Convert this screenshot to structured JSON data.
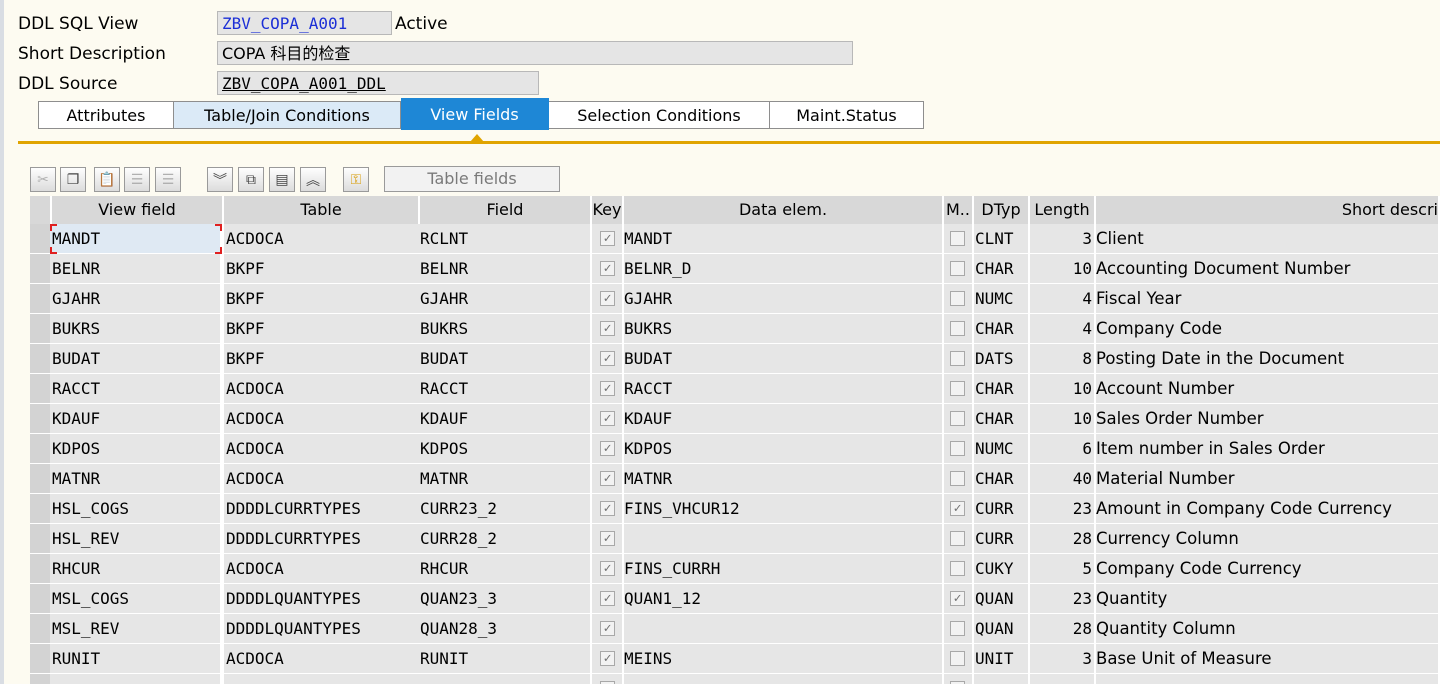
{
  "header": {
    "ddl_sql_view_label": "DDL SQL View",
    "ddl_sql_view_value": "ZBV_COPA_A001",
    "status": "Active",
    "short_description_label": "Short Description",
    "short_description_value": "COPA 科目的检查",
    "ddl_source_label": "DDL Source",
    "ddl_source_value": "ZBV_COPA_A001_DDL"
  },
  "tabs": [
    {
      "label": "Attributes"
    },
    {
      "label": "Table/Join Conditions"
    },
    {
      "label": "View Fields"
    },
    {
      "label": "Selection Conditions"
    },
    {
      "label": "Maint.Status"
    }
  ],
  "toolbar": {
    "table_fields_label": "Table fields",
    "icons": [
      "cut-icon",
      "copy-icon",
      "paste-icon",
      "insert-row-icon",
      "delete-row-icon",
      "collapse-icon",
      "table-insert-icon",
      "table-select-icon",
      "expand-icon",
      "key-icon"
    ]
  },
  "columns": {
    "view_field": "View field",
    "table": "Table",
    "field": "Field",
    "key": "Key",
    "data_elem": "Data elem.",
    "mod": "M..",
    "dtyp": "DTyp",
    "length": "Length",
    "short_desc": "Short descri"
  },
  "rows": [
    {
      "view_field": "MANDT",
      "table": "ACDOCA",
      "field": "RCLNT",
      "key": true,
      "data_elem": "MANDT",
      "mod": false,
      "dtyp": "CLNT",
      "length": "3",
      "desc": "Client"
    },
    {
      "view_field": "BELNR",
      "table": "BKPF",
      "field": "BELNR",
      "key": true,
      "data_elem": "BELNR_D",
      "mod": false,
      "dtyp": "CHAR",
      "length": "10",
      "desc": "Accounting Document Number"
    },
    {
      "view_field": "GJAHR",
      "table": "BKPF",
      "field": "GJAHR",
      "key": true,
      "data_elem": "GJAHR",
      "mod": false,
      "dtyp": "NUMC",
      "length": "4",
      "desc": "Fiscal Year"
    },
    {
      "view_field": "BUKRS",
      "table": "BKPF",
      "field": "BUKRS",
      "key": true,
      "data_elem": "BUKRS",
      "mod": false,
      "dtyp": "CHAR",
      "length": "4",
      "desc": "Company Code"
    },
    {
      "view_field": "BUDAT",
      "table": "BKPF",
      "field": "BUDAT",
      "key": true,
      "data_elem": "BUDAT",
      "mod": false,
      "dtyp": "DATS",
      "length": "8",
      "desc": "Posting Date in the Document"
    },
    {
      "view_field": "RACCT",
      "table": "ACDOCA",
      "field": "RACCT",
      "key": true,
      "data_elem": "RACCT",
      "mod": false,
      "dtyp": "CHAR",
      "length": "10",
      "desc": "Account Number"
    },
    {
      "view_field": "KDAUF",
      "table": "ACDOCA",
      "field": "KDAUF",
      "key": true,
      "data_elem": "KDAUF",
      "mod": false,
      "dtyp": "CHAR",
      "length": "10",
      "desc": "Sales Order Number"
    },
    {
      "view_field": "KDPOS",
      "table": "ACDOCA",
      "field": "KDPOS",
      "key": true,
      "data_elem": "KDPOS",
      "mod": false,
      "dtyp": "NUMC",
      "length": "6",
      "desc": "Item number in Sales Order"
    },
    {
      "view_field": "MATNR",
      "table": "ACDOCA",
      "field": "MATNR",
      "key": true,
      "data_elem": "MATNR",
      "mod": false,
      "dtyp": "CHAR",
      "length": "40",
      "desc": "Material Number"
    },
    {
      "view_field": "HSL_COGS",
      "table": "DDDDLCURRTYPES",
      "field": "CURR23_2",
      "key": true,
      "data_elem": "FINS_VHCUR12",
      "mod": true,
      "dtyp": "CURR",
      "length": "23",
      "desc": "Amount in Company Code Currency"
    },
    {
      "view_field": "HSL_REV",
      "table": "DDDDLCURRTYPES",
      "field": "CURR28_2",
      "key": true,
      "data_elem": "",
      "mod": false,
      "dtyp": "CURR",
      "length": "28",
      "desc": "Currency Column"
    },
    {
      "view_field": "RHCUR",
      "table": "ACDOCA",
      "field": "RHCUR",
      "key": true,
      "data_elem": "FINS_CURRH",
      "mod": false,
      "dtyp": "CUKY",
      "length": "5",
      "desc": "Company Code Currency"
    },
    {
      "view_field": "MSL_COGS",
      "table": "DDDDLQUANTYPES",
      "field": "QUAN23_3",
      "key": true,
      "data_elem": "QUAN1_12",
      "mod": true,
      "dtyp": "QUAN",
      "length": "23",
      "desc": "Quantity"
    },
    {
      "view_field": "MSL_REV",
      "table": "DDDDLQUANTYPES",
      "field": "QUAN28_3",
      "key": true,
      "data_elem": "",
      "mod": false,
      "dtyp": "QUAN",
      "length": "28",
      "desc": "Quantity Column"
    },
    {
      "view_field": "RUNIT",
      "table": "ACDOCA",
      "field": "RUNIT",
      "key": true,
      "data_elem": "MEINS",
      "mod": false,
      "dtyp": "UNIT",
      "length": "3",
      "desc": "Base Unit of Measure"
    }
  ]
}
